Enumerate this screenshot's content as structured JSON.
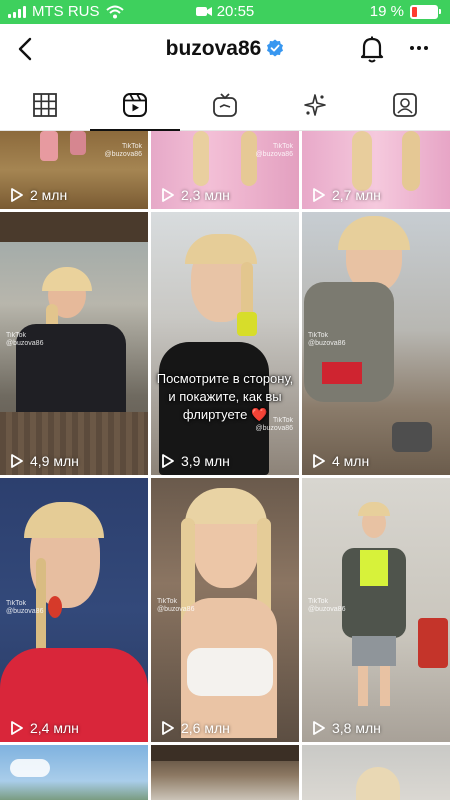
{
  "status": {
    "carrier": "MTS RUS",
    "time": "20:55",
    "battery": "19 %",
    "battery_level": 0.19
  },
  "header": {
    "username": "buzova86",
    "verified": true
  },
  "tabs": [
    {
      "name": "grid-tab",
      "icon": "grid-icon",
      "active": false
    },
    {
      "name": "reels-tab",
      "icon": "reels-icon",
      "active": true
    },
    {
      "name": "igtv-tab",
      "icon": "igtv-icon",
      "active": false
    },
    {
      "name": "effects-tab",
      "icon": "sparkle-icon",
      "active": false
    },
    {
      "name": "tagged-tab",
      "icon": "tagged-person-icon",
      "active": false
    }
  ],
  "reels": [
    {
      "views": "2 млн"
    },
    {
      "views": "2,3 млн"
    },
    {
      "views": "2,7 млн"
    },
    {
      "views": "4,9 млн"
    },
    {
      "views": "3,9 млн",
      "caption": "Посмотрите в сторону, и покажите, как вы флиртуете ❤️"
    },
    {
      "views": "4 млн"
    },
    {
      "views": "2,4 млн"
    },
    {
      "views": "2,6 млн"
    },
    {
      "views": "3,8 млн"
    },
    {},
    {},
    {}
  ],
  "watermark": {
    "brand": "TikTok",
    "handle": "@buzova86"
  },
  "colors": {
    "status_bar": "#3ed05d",
    "verified": "#3897f0",
    "battery_low": "#ff3b30"
  }
}
